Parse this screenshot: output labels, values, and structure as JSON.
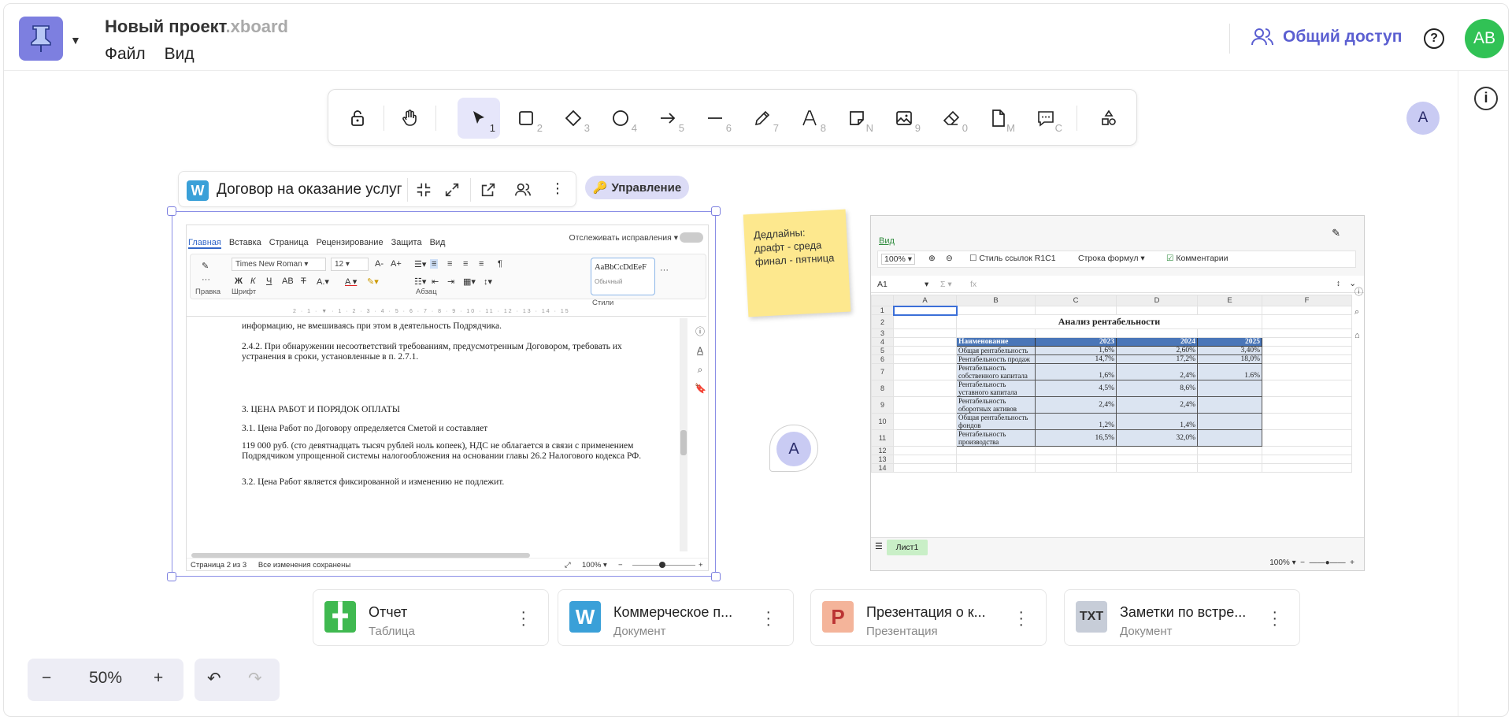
{
  "header": {
    "project_name": "Новый проект",
    "extension": ".xboard",
    "menu": [
      "Файл",
      "Вид"
    ],
    "share_label": "Общий доступ",
    "help_icon": "help-icon",
    "user_initials": "AB"
  },
  "toolbar": {
    "tools": [
      {
        "icon": "lock-icon",
        "key": ""
      },
      {
        "icon": "hand-icon",
        "key": ""
      },
      {
        "icon": "cursor-icon",
        "key": "1",
        "active": true
      },
      {
        "icon": "rectangle-icon",
        "key": "2"
      },
      {
        "icon": "diamond-icon",
        "key": "3"
      },
      {
        "icon": "circle-icon",
        "key": "4"
      },
      {
        "icon": "arrow-icon",
        "key": "5"
      },
      {
        "icon": "line-icon",
        "key": "6"
      },
      {
        "icon": "pencil-icon",
        "key": "7"
      },
      {
        "icon": "text-icon",
        "key": "8"
      },
      {
        "icon": "sticky-note-icon",
        "key": "N"
      },
      {
        "icon": "image-icon",
        "key": "9"
      },
      {
        "icon": "eraser-icon",
        "key": "0"
      },
      {
        "icon": "document-icon",
        "key": "M"
      },
      {
        "icon": "comment-icon",
        "key": "C"
      },
      {
        "icon": "shapes-icon",
        "key": ""
      }
    ],
    "avatar": "A"
  },
  "document": {
    "title": "Договор на оказание услуг",
    "manage_label": "Управление",
    "ribbon_tabs": [
      "Главная",
      "Вставка",
      "Страница",
      "Рецензирование",
      "Защита",
      "Вид"
    ],
    "track_changes": "Отслеживать исправления",
    "font_name": "Times New Roman",
    "font_size": "12",
    "style_sample": "AaBbCcDdEeF",
    "style_name": "Обычный",
    "group_labels": [
      "Правка",
      "Шрифт",
      "Абзац",
      "Стили"
    ],
    "paragraphs": [
      "информацию, не вмешиваясь при этом в деятельность Подрядчика.",
      "2.4.2. При обнаружении несоответствий требованиям, предусмотренным Договором, требовать их устранения в сроки, установленные в п. 2.7.1.",
      "3. ЦЕНА РАБОТ И ПОРЯДОК ОПЛАТЫ",
      "3.1. Цена Работ по Договору определяется Сметой и составляет",
      "119 000 руб. (сто девятнадцать тысяч рублей ноль копеек), НДС не облагается в связи с применением Подрядчиком упрощенной системы налогообложения на основании главы 26.2 Налогового кодекса РФ.",
      "3.2. Цена Работ является фиксированной и изменению не подлежит."
    ],
    "status_page": "Страница 2 из 3",
    "status_saved": "Все изменения сохранены",
    "zoom": "100%"
  },
  "sticky": {
    "text": "Дедлайны:\nдрафт - среда\nфинал - пятница"
  },
  "comment_avatar": "A",
  "sheet": {
    "tab": "Вид",
    "zoom": "100%",
    "r1c1": "Стиль ссылок R1C1",
    "formula_row": "Строка формул",
    "comments": "Комментарии",
    "cell_ref": "A1",
    "fx": "fx",
    "columns": [
      "A",
      "B",
      "C",
      "D",
      "E",
      "F"
    ],
    "table_title": "Анализ рентабельности",
    "headers": [
      "Наименование",
      "2023",
      "2024",
      "2025"
    ],
    "rows": [
      {
        "r": "5",
        "name": "Общая рентабельность",
        "v": [
          "1,6%",
          "2,60%",
          "3,40%"
        ]
      },
      {
        "r": "6",
        "name": "Рентабельность продаж",
        "v": [
          "14,7%",
          "17,2%",
          "18,0%"
        ]
      },
      {
        "r": "7",
        "name": "Рентабельность собственного капитала",
        "v": [
          "1,6%",
          "2,4%",
          "1.6%"
        ]
      },
      {
        "r": "8",
        "name": "Рентабельность уставного капитала",
        "v": [
          "4,5%",
          "8,6%",
          ""
        ]
      },
      {
        "r": "9",
        "name": "Рентабельность оборотных активов",
        "v": [
          "2,4%",
          "2,4%",
          ""
        ]
      },
      {
        "r": "10",
        "name": "Общая рентабельность фондов",
        "v": [
          "1,2%",
          "1,4%",
          ""
        ]
      },
      {
        "r": "11",
        "name": "Рентабельность производства",
        "v": [
          "16,5%",
          "32,0%",
          ""
        ]
      }
    ],
    "sheet_tab": "Лист1",
    "bottom_zoom": "100%"
  },
  "files": [
    {
      "name": "Отчет",
      "type": "Таблица",
      "icon": "spreadsheet-icon",
      "color": "#3fb950"
    },
    {
      "name": "Коммерческое п...",
      "type": "Документ",
      "icon": "word-icon",
      "color": "#3aa0d8"
    },
    {
      "name": "Презентация о к...",
      "type": "Презентация",
      "icon": "presentation-icon",
      "color": "#f08a5d"
    },
    {
      "name": "Заметки по встре...",
      "type": "Документ",
      "icon": "txt-icon",
      "color": "#9aa3b5"
    }
  ],
  "zoom": {
    "value": "50%",
    "minus": "−",
    "plus": "+"
  }
}
